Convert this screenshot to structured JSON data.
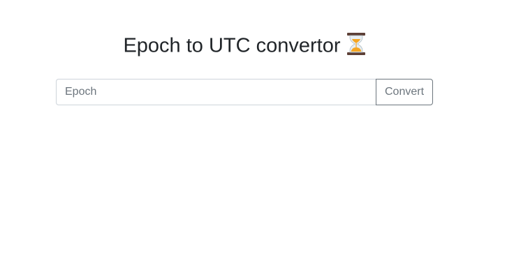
{
  "header": {
    "title": "Epoch to UTC convertor",
    "title_icon": "hourglass-icon"
  },
  "form": {
    "epoch_placeholder": "Epoch",
    "epoch_value": "",
    "convert_label": "Convert"
  },
  "colors": {
    "text": "#212529",
    "input_border": "#ced4da",
    "button_border": "#6c757d",
    "button_text": "#6c757d",
    "hourglass_frame": "#5d4037",
    "hourglass_sand": "#f5a623"
  }
}
